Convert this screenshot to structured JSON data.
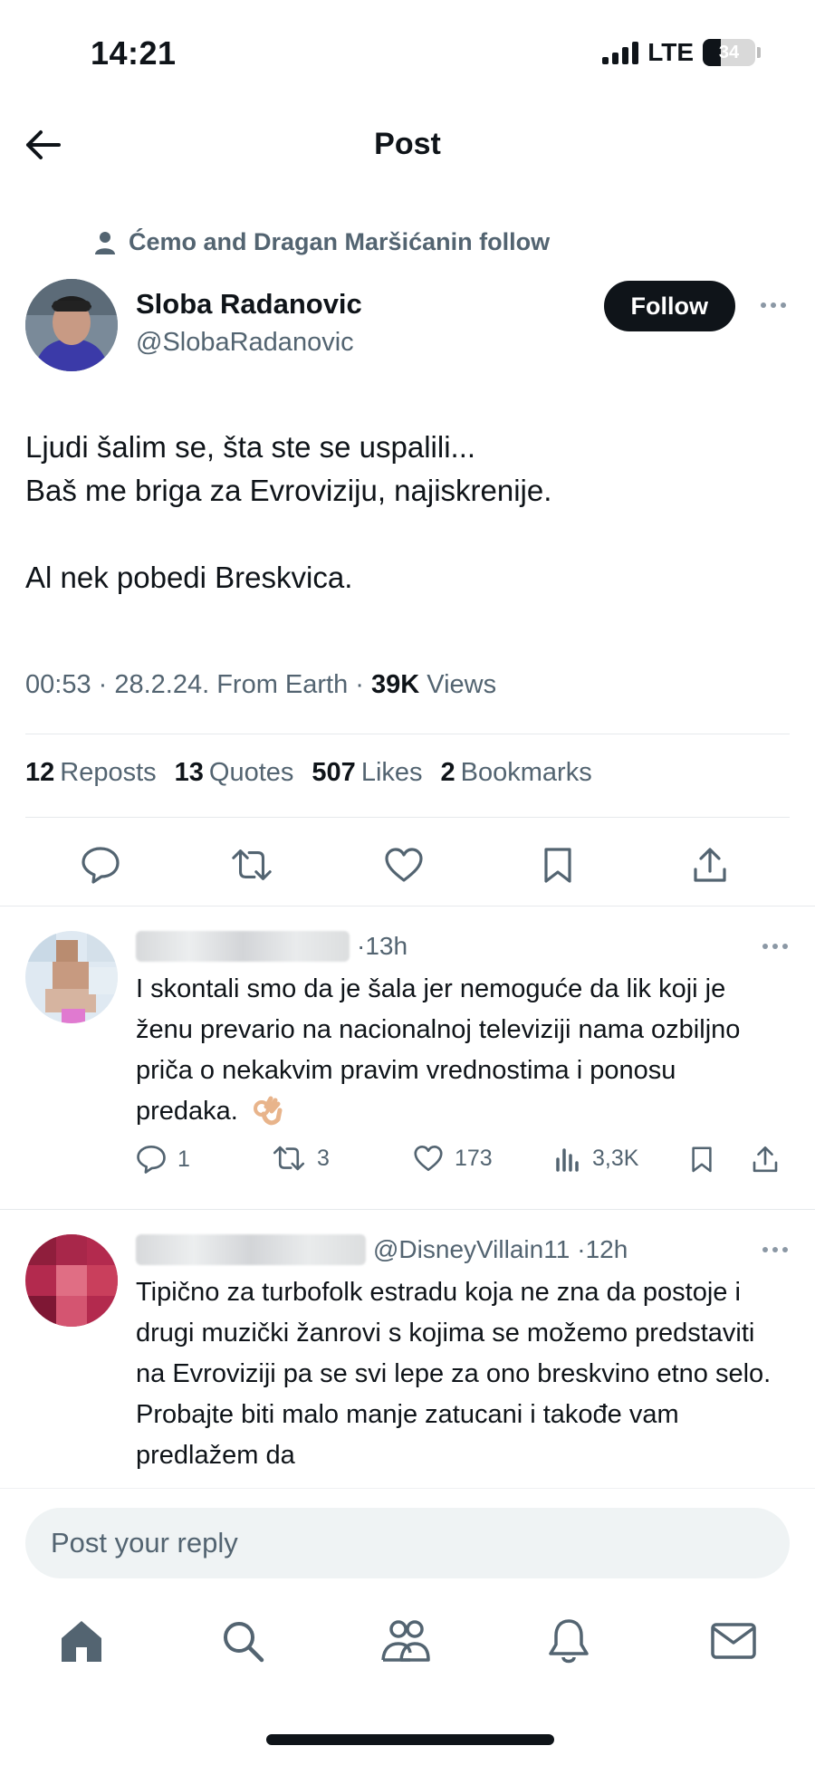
{
  "status_bar": {
    "time": "14:21",
    "network": "LTE",
    "battery": "34",
    "battery_level": 0.34
  },
  "header": {
    "title": "Post"
  },
  "social_context": {
    "text": "Ćemo and Dragan Maršićanin follow"
  },
  "author": {
    "name": "Sloba Radanovic",
    "handle": "@SlobaRadanovic",
    "follow_label": "Follow"
  },
  "post": {
    "lines": [
      "Ljudi šalim se, šta ste se uspalili...",
      "Baš me briga za Evroviziju, najiskrenije.",
      "",
      "Al nek pobedi Breskvica."
    ],
    "meta_prefix": "00:53 · 28.2.24. From Earth · ",
    "views_count": "39K",
    "views_label": " Views"
  },
  "stats": [
    {
      "count": "12",
      "label": "Reposts"
    },
    {
      "count": "13",
      "label": "Quotes"
    },
    {
      "count": "507",
      "label": "Likes"
    },
    {
      "count": "2",
      "label": "Bookmarks"
    }
  ],
  "post_actions": [
    "reply-icon",
    "repost-icon",
    "like-icon",
    "bookmark-icon",
    "share-icon"
  ],
  "replies": [
    {
      "time": "·13h",
      "text": "I skontali smo da je šala jer nemoguće da lik koji je ženu prevario na nacionalnoj televiziji nama ozbiljno priča o nekakvim pravim vrednostima i ponosu predaka.",
      "emoji": "ok-hand",
      "replies": "1",
      "reposts": "3",
      "likes": "173",
      "views": "3,3K"
    },
    {
      "handle": "@DisneyVillain11",
      "time": "·12h",
      "text": "Tipično za turbofolk estradu koja ne zna da postoje i drugi muzički žanrovi s kojima se možemo predstaviti na Evroviziji pa se svi lepe za ono breskvino etno selo. Probajte biti malo manje zatucani i takođe vam predlažem da"
    }
  ],
  "reply_box": {
    "placeholder": "Post your reply"
  },
  "tabbar": [
    "home-icon",
    "search-icon",
    "communities-icon",
    "notifications-icon",
    "messages-icon"
  ],
  "colors": {
    "text": "#0f1419",
    "secondary": "#536471",
    "divider": "#e6e9ec",
    "follow_bg": "#0f1419",
    "input_bg": "#eff3f4"
  }
}
